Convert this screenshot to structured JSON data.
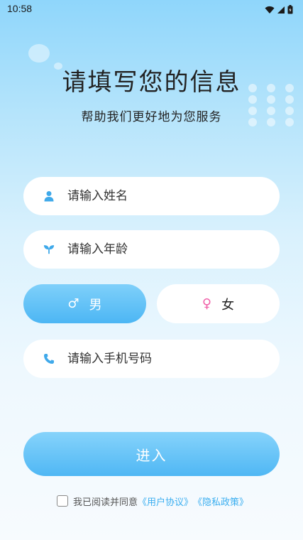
{
  "status_bar": {
    "time": "10:58",
    "icons": [
      "wifi-icon",
      "signal-icon",
      "battery-icon"
    ]
  },
  "header": {
    "title": "请填写您的信息",
    "subtitle": "帮助我们更好地为您服务"
  },
  "form": {
    "name": {
      "placeholder": "请输入姓名",
      "icon": "user-icon"
    },
    "age": {
      "placeholder": "请输入年龄",
      "icon": "sprout-icon"
    },
    "gender": {
      "male_label": "男",
      "male_symbol": "♂",
      "female_label": "女",
      "female_symbol": "♀",
      "selected": "男"
    },
    "phone": {
      "placeholder": "请输入手机号码",
      "icon": "phone-icon"
    },
    "submit_label": "进入"
  },
  "agreement": {
    "text": "我已阅读并同意",
    "user_agreement": "《用户协议》",
    "privacy_policy": "《隐私政策》",
    "checked": false
  },
  "colors": {
    "accent": "#4fb7f4",
    "link": "#3aaef0",
    "female_symbol": "#f05fa8"
  }
}
